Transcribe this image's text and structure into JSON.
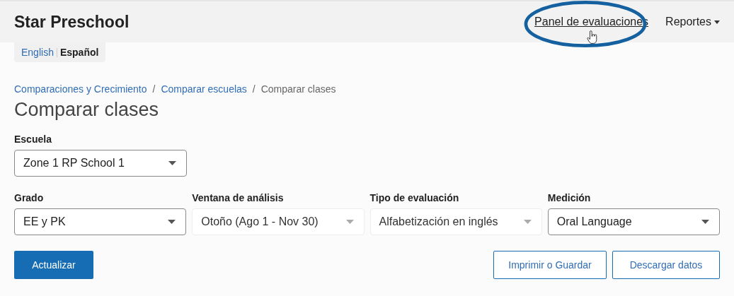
{
  "header": {
    "title": "Star Preschool",
    "nav": [
      {
        "label": "Panel de evaluaciones",
        "kind": "link",
        "highlighted": true
      },
      {
        "label": "Reportes",
        "kind": "dropdown",
        "highlighted": false
      }
    ]
  },
  "languages": [
    {
      "label": "English",
      "selected": false
    },
    {
      "label": "Español",
      "selected": true
    }
  ],
  "breadcrumb_separator": "/",
  "breadcrumb": [
    {
      "label": "Comparaciones y Crecimiento",
      "current": false
    },
    {
      "label": "Comparar escuelas",
      "current": false
    },
    {
      "label": "Comparar clases",
      "current": true
    }
  ],
  "page_title": "Comparar clases",
  "filter_rows": [
    [
      {
        "label": "Escuela",
        "value": "Zone 1 RP School 1",
        "disabled": false
      }
    ],
    [
      {
        "label": "Grado",
        "value": "EE y PK",
        "disabled": false
      },
      {
        "label": "Ventana de análisis",
        "value": "Otoño (Ago 1 - Nov 30)",
        "disabled": true
      },
      {
        "label": "Tipo de evaluación",
        "value": "Alfabetización en inglés",
        "disabled": true
      },
      {
        "label": "Medición",
        "value": "Oral Language",
        "disabled": false
      }
    ]
  ],
  "actions": [
    {
      "label": "Actualizar",
      "kind": "primary"
    },
    {
      "label": "Imprimir o Guardar",
      "kind": "outline"
    },
    {
      "label": "Descargar datos",
      "kind": "outline"
    }
  ]
}
